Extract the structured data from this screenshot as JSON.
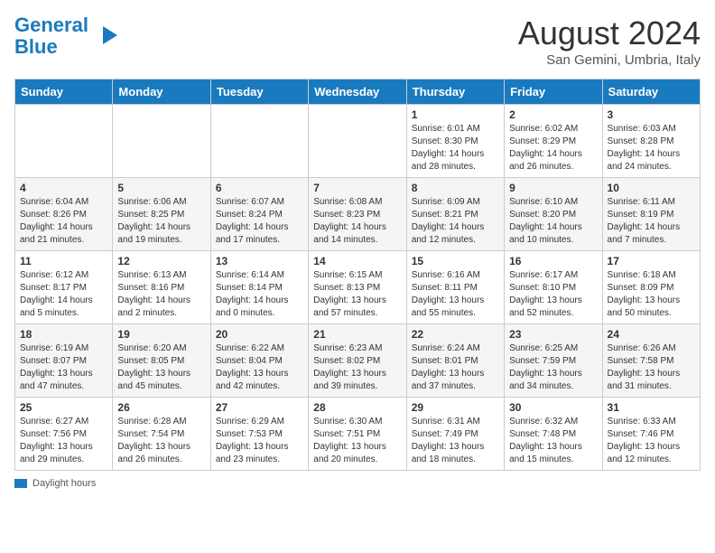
{
  "header": {
    "logo_line1": "General",
    "logo_line2": "Blue",
    "month_year": "August 2024",
    "location": "San Gemini, Umbria, Italy"
  },
  "days_of_week": [
    "Sunday",
    "Monday",
    "Tuesday",
    "Wednesday",
    "Thursday",
    "Friday",
    "Saturday"
  ],
  "legend": {
    "icon": "bar",
    "text": "Daylight hours"
  },
  "weeks": [
    [
      {
        "day": "",
        "info": ""
      },
      {
        "day": "",
        "info": ""
      },
      {
        "day": "",
        "info": ""
      },
      {
        "day": "",
        "info": ""
      },
      {
        "day": "1",
        "info": "Sunrise: 6:01 AM\nSunset: 8:30 PM\nDaylight: 14 hours\nand 28 minutes."
      },
      {
        "day": "2",
        "info": "Sunrise: 6:02 AM\nSunset: 8:29 PM\nDaylight: 14 hours\nand 26 minutes."
      },
      {
        "day": "3",
        "info": "Sunrise: 6:03 AM\nSunset: 8:28 PM\nDaylight: 14 hours\nand 24 minutes."
      }
    ],
    [
      {
        "day": "4",
        "info": "Sunrise: 6:04 AM\nSunset: 8:26 PM\nDaylight: 14 hours\nand 21 minutes."
      },
      {
        "day": "5",
        "info": "Sunrise: 6:06 AM\nSunset: 8:25 PM\nDaylight: 14 hours\nand 19 minutes."
      },
      {
        "day": "6",
        "info": "Sunrise: 6:07 AM\nSunset: 8:24 PM\nDaylight: 14 hours\nand 17 minutes."
      },
      {
        "day": "7",
        "info": "Sunrise: 6:08 AM\nSunset: 8:23 PM\nDaylight: 14 hours\nand 14 minutes."
      },
      {
        "day": "8",
        "info": "Sunrise: 6:09 AM\nSunset: 8:21 PM\nDaylight: 14 hours\nand 12 minutes."
      },
      {
        "day": "9",
        "info": "Sunrise: 6:10 AM\nSunset: 8:20 PM\nDaylight: 14 hours\nand 10 minutes."
      },
      {
        "day": "10",
        "info": "Sunrise: 6:11 AM\nSunset: 8:19 PM\nDaylight: 14 hours\nand 7 minutes."
      }
    ],
    [
      {
        "day": "11",
        "info": "Sunrise: 6:12 AM\nSunset: 8:17 PM\nDaylight: 14 hours\nand 5 minutes."
      },
      {
        "day": "12",
        "info": "Sunrise: 6:13 AM\nSunset: 8:16 PM\nDaylight: 14 hours\nand 2 minutes."
      },
      {
        "day": "13",
        "info": "Sunrise: 6:14 AM\nSunset: 8:14 PM\nDaylight: 14 hours\nand 0 minutes."
      },
      {
        "day": "14",
        "info": "Sunrise: 6:15 AM\nSunset: 8:13 PM\nDaylight: 13 hours\nand 57 minutes."
      },
      {
        "day": "15",
        "info": "Sunrise: 6:16 AM\nSunset: 8:11 PM\nDaylight: 13 hours\nand 55 minutes."
      },
      {
        "day": "16",
        "info": "Sunrise: 6:17 AM\nSunset: 8:10 PM\nDaylight: 13 hours\nand 52 minutes."
      },
      {
        "day": "17",
        "info": "Sunrise: 6:18 AM\nSunset: 8:09 PM\nDaylight: 13 hours\nand 50 minutes."
      }
    ],
    [
      {
        "day": "18",
        "info": "Sunrise: 6:19 AM\nSunset: 8:07 PM\nDaylight: 13 hours\nand 47 minutes."
      },
      {
        "day": "19",
        "info": "Sunrise: 6:20 AM\nSunset: 8:05 PM\nDaylight: 13 hours\nand 45 minutes."
      },
      {
        "day": "20",
        "info": "Sunrise: 6:22 AM\nSunset: 8:04 PM\nDaylight: 13 hours\nand 42 minutes."
      },
      {
        "day": "21",
        "info": "Sunrise: 6:23 AM\nSunset: 8:02 PM\nDaylight: 13 hours\nand 39 minutes."
      },
      {
        "day": "22",
        "info": "Sunrise: 6:24 AM\nSunset: 8:01 PM\nDaylight: 13 hours\nand 37 minutes."
      },
      {
        "day": "23",
        "info": "Sunrise: 6:25 AM\nSunset: 7:59 PM\nDaylight: 13 hours\nand 34 minutes."
      },
      {
        "day": "24",
        "info": "Sunrise: 6:26 AM\nSunset: 7:58 PM\nDaylight: 13 hours\nand 31 minutes."
      }
    ],
    [
      {
        "day": "25",
        "info": "Sunrise: 6:27 AM\nSunset: 7:56 PM\nDaylight: 13 hours\nand 29 minutes."
      },
      {
        "day": "26",
        "info": "Sunrise: 6:28 AM\nSunset: 7:54 PM\nDaylight: 13 hours\nand 26 minutes."
      },
      {
        "day": "27",
        "info": "Sunrise: 6:29 AM\nSunset: 7:53 PM\nDaylight: 13 hours\nand 23 minutes."
      },
      {
        "day": "28",
        "info": "Sunrise: 6:30 AM\nSunset: 7:51 PM\nDaylight: 13 hours\nand 20 minutes."
      },
      {
        "day": "29",
        "info": "Sunrise: 6:31 AM\nSunset: 7:49 PM\nDaylight: 13 hours\nand 18 minutes."
      },
      {
        "day": "30",
        "info": "Sunrise: 6:32 AM\nSunset: 7:48 PM\nDaylight: 13 hours\nand 15 minutes."
      },
      {
        "day": "31",
        "info": "Sunrise: 6:33 AM\nSunset: 7:46 PM\nDaylight: 13 hours\nand 12 minutes."
      }
    ]
  ]
}
